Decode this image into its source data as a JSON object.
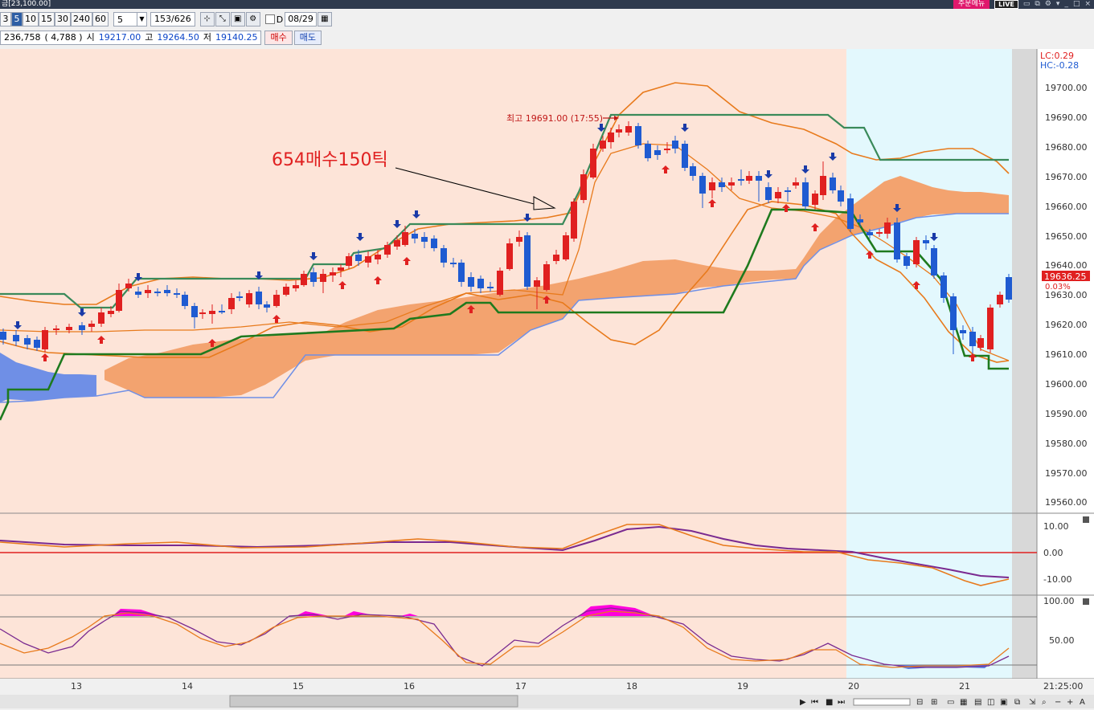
{
  "window": {
    "title": "금[23,100.00]",
    "live_label": "LIVE",
    "promo_label": "주문메뉴"
  },
  "toolbar": {
    "timeframes": [
      "3",
      "5",
      "10",
      "15",
      "30",
      "240",
      "60"
    ],
    "selected_timeframe": "5",
    "interval_value": "5",
    "count": "153",
    "count_total": "/626",
    "d_label": "D",
    "date": "08/29"
  },
  "quote": {
    "volume": "236,758",
    "volume_change": "( 4,788 )",
    "open_label": "시",
    "open": "19217.00",
    "high_label": "고",
    "high": "19264.50",
    "low_label": "저",
    "low": "19140.25",
    "buy_label": "매수",
    "sell_label": "매도"
  },
  "annotation": {
    "main": "654매수150틱",
    "high_note": "최고 19691.00 (17:55)"
  },
  "price_axis": {
    "labels": [
      "19700.00",
      "19690.00",
      "19680.00",
      "19670.00",
      "19660.00",
      "19650.00",
      "19640.00",
      "19630.00",
      "19620.00",
      "19610.00",
      "19600.00",
      "19590.00",
      "19580.00",
      "19570.00",
      "19560.00"
    ],
    "lc": "LC:0.29",
    "hc": "HC:-0.28",
    "current": "19636.25",
    "current_pct": "0.03%"
  },
  "osc_axis": {
    "labels": [
      "10.00",
      "0.00",
      "-10.00"
    ]
  },
  "stoch_axis": {
    "labels": [
      "100.00",
      "50.00"
    ]
  },
  "time_axis": {
    "labels": [
      "13",
      "14",
      "15",
      "16",
      "17",
      "18",
      "19",
      "20",
      "21"
    ],
    "right_time": "21:25:00"
  },
  "colors": {
    "session_bg": "#fde4d8",
    "night_bg": "#e3f8fd",
    "up": "#e02020",
    "down": "#1f5bd1",
    "cloud_bull": "#f3a36f",
    "cloud_bear": "#6f8fe6",
    "kijun": "#1e7a1e",
    "tenkan": "#3a8a5a",
    "bb": "#e87a1c",
    "magenta": "#ff00dd"
  }
}
